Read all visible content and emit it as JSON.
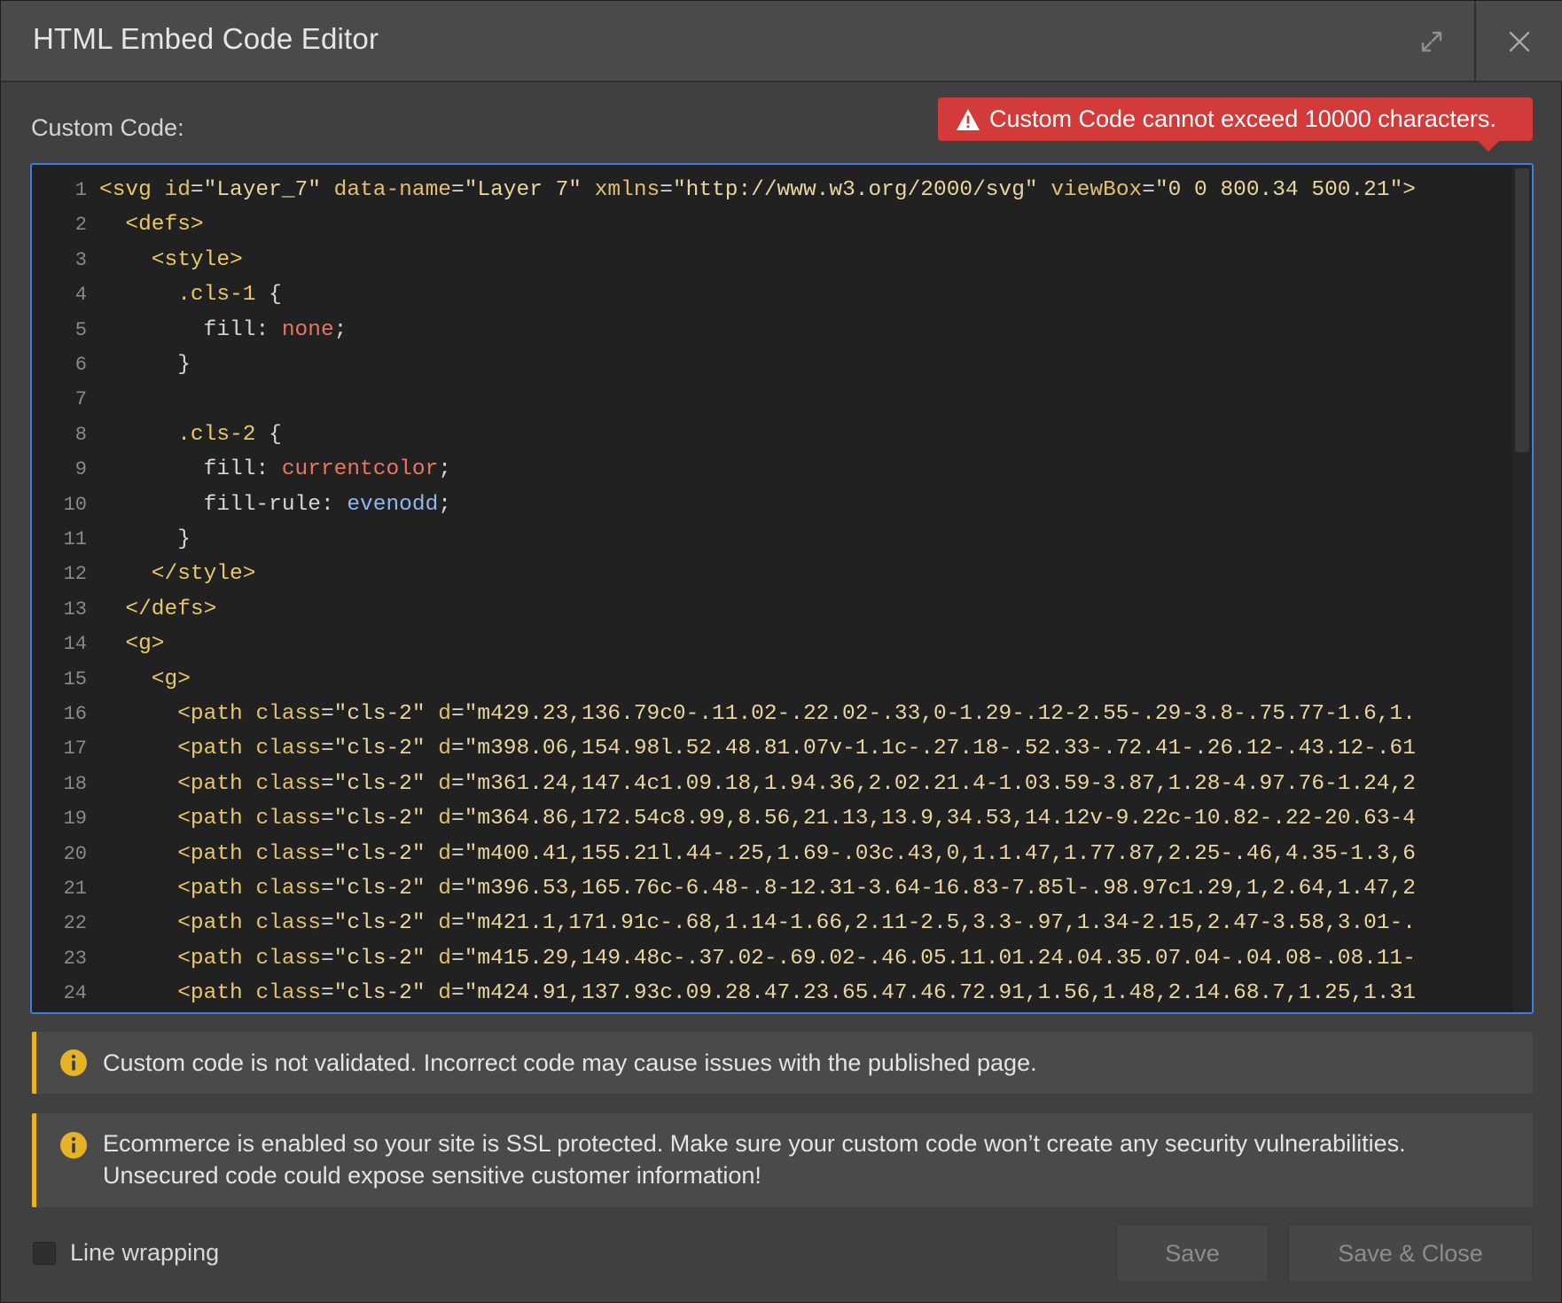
{
  "dialog": {
    "title": "HTML Embed Code Editor",
    "expand_icon": "expand-icon",
    "close_icon": "close-icon"
  },
  "editor": {
    "label": "Custom Code:",
    "error": "Custom Code cannot exceed 10000 characters.",
    "lines": [
      {
        "n": "1",
        "tokens": [
          [
            "tag",
            "<svg "
          ],
          [
            "attr",
            "id"
          ],
          [
            "punc",
            "="
          ],
          [
            "str",
            "\"Layer_7\" "
          ],
          [
            "attr",
            "data-name"
          ],
          [
            "punc",
            "="
          ],
          [
            "str",
            "\"Layer 7\" "
          ],
          [
            "attr",
            "xmlns"
          ],
          [
            "punc",
            "="
          ],
          [
            "str",
            "\"http://www.w3.org/2000/svg\" "
          ],
          [
            "attr",
            "viewBox"
          ],
          [
            "punc",
            "="
          ],
          [
            "str",
            "\"0 0 800.34 500.21\">"
          ]
        ]
      },
      {
        "n": "2",
        "tokens": [
          [
            "tag",
            "  <defs>"
          ]
        ]
      },
      {
        "n": "3",
        "tokens": [
          [
            "tag",
            "    <style>"
          ]
        ]
      },
      {
        "n": "4",
        "tokens": [
          [
            "sel",
            "      .cls-1 "
          ],
          [
            "punc",
            "{"
          ]
        ]
      },
      {
        "n": "5",
        "tokens": [
          [
            "prop",
            "        fill"
          ],
          [
            "punc",
            ": "
          ],
          [
            "valred",
            "none"
          ],
          [
            "punc",
            ";"
          ]
        ]
      },
      {
        "n": "6",
        "tokens": [
          [
            "punc",
            "      }"
          ]
        ]
      },
      {
        "n": "7",
        "tokens": []
      },
      {
        "n": "8",
        "tokens": [
          [
            "sel",
            "      .cls-2 "
          ],
          [
            "punc",
            "{"
          ]
        ]
      },
      {
        "n": "9",
        "tokens": [
          [
            "prop",
            "        fill"
          ],
          [
            "punc",
            ": "
          ],
          [
            "valred",
            "currentcolor"
          ],
          [
            "punc",
            ";"
          ]
        ]
      },
      {
        "n": "10",
        "tokens": [
          [
            "prop",
            "        fill-rule"
          ],
          [
            "punc",
            ": "
          ],
          [
            "valblue",
            "evenodd"
          ],
          [
            "punc",
            ";"
          ]
        ]
      },
      {
        "n": "11",
        "tokens": [
          [
            "punc",
            "      }"
          ]
        ]
      },
      {
        "n": "12",
        "tokens": [
          [
            "tag",
            "    </style>"
          ]
        ]
      },
      {
        "n": "13",
        "tokens": [
          [
            "tag",
            "  </defs>"
          ]
        ]
      },
      {
        "n": "14",
        "tokens": [
          [
            "tag",
            "  <g>"
          ]
        ]
      },
      {
        "n": "15",
        "tokens": [
          [
            "tag",
            "    <g>"
          ]
        ]
      },
      {
        "n": "16",
        "tokens": [
          [
            "tag",
            "      <path "
          ],
          [
            "attr",
            "class"
          ],
          [
            "punc",
            "="
          ],
          [
            "str",
            "\"cls-2\" "
          ],
          [
            "attr",
            "d"
          ],
          [
            "punc",
            "="
          ],
          [
            "str",
            "\"m429.23,136.79c0-.11.02-.22.02-.33,0-1.29-.12-2.55-.29-3.8-.75.77-1.6,1."
          ]
        ]
      },
      {
        "n": "17",
        "tokens": [
          [
            "tag",
            "      <path "
          ],
          [
            "attr",
            "class"
          ],
          [
            "punc",
            "="
          ],
          [
            "str",
            "\"cls-2\" "
          ],
          [
            "attr",
            "d"
          ],
          [
            "punc",
            "="
          ],
          [
            "str",
            "\"m398.06,154.98l.52.48.81.07v-1.1c-.27.18-.52.33-.72.41-.26.12-.43.12-.61"
          ]
        ]
      },
      {
        "n": "18",
        "tokens": [
          [
            "tag",
            "      <path "
          ],
          [
            "attr",
            "class"
          ],
          [
            "punc",
            "="
          ],
          [
            "str",
            "\"cls-2\" "
          ],
          [
            "attr",
            "d"
          ],
          [
            "punc",
            "="
          ],
          [
            "str",
            "\"m361.24,147.4c1.09.18,1.94.36,2.02.21.4-1.03.59-3.87,1.28-4.97.76-1.24,2"
          ]
        ]
      },
      {
        "n": "19",
        "tokens": [
          [
            "tag",
            "      <path "
          ],
          [
            "attr",
            "class"
          ],
          [
            "punc",
            "="
          ],
          [
            "str",
            "\"cls-2\" "
          ],
          [
            "attr",
            "d"
          ],
          [
            "punc",
            "="
          ],
          [
            "str",
            "\"m364.86,172.54c8.99,8.56,21.13,13.9,34.53,14.12v-9.22c-10.82-.22-20.63-4"
          ]
        ]
      },
      {
        "n": "20",
        "tokens": [
          [
            "tag",
            "      <path "
          ],
          [
            "attr",
            "class"
          ],
          [
            "punc",
            "="
          ],
          [
            "str",
            "\"cls-2\" "
          ],
          [
            "attr",
            "d"
          ],
          [
            "punc",
            "="
          ],
          [
            "str",
            "\"m400.41,155.21l.44-.25,1.69-.03c.43,0,1.1.47,1.77.87,2.25-.46,4.35-1.3,6"
          ]
        ]
      },
      {
        "n": "21",
        "tokens": [
          [
            "tag",
            "      <path "
          ],
          [
            "attr",
            "class"
          ],
          [
            "punc",
            "="
          ],
          [
            "str",
            "\"cls-2\" "
          ],
          [
            "attr",
            "d"
          ],
          [
            "punc",
            "="
          ],
          [
            "str",
            "\"m396.53,165.76c-6.48-.8-12.31-3.64-16.83-7.85l-.98.97c1.29,1,2.64,1.47,2"
          ]
        ]
      },
      {
        "n": "22",
        "tokens": [
          [
            "tag",
            "      <path "
          ],
          [
            "attr",
            "class"
          ],
          [
            "punc",
            "="
          ],
          [
            "str",
            "\"cls-2\" "
          ],
          [
            "attr",
            "d"
          ],
          [
            "punc",
            "="
          ],
          [
            "str",
            "\"m421.1,171.91c-.68,1.14-1.66,2.11-2.5,3.3-.97,1.34-2.15,2.47-3.58,3.01-."
          ]
        ]
      },
      {
        "n": "23",
        "tokens": [
          [
            "tag",
            "      <path "
          ],
          [
            "attr",
            "class"
          ],
          [
            "punc",
            "="
          ],
          [
            "str",
            "\"cls-2\" "
          ],
          [
            "attr",
            "d"
          ],
          [
            "punc",
            "="
          ],
          [
            "str",
            "\"m415.29,149.48c-.37.02-.69.02-.46.05.11.01.24.04.35.07.04-.04.08-.08.11-"
          ]
        ]
      },
      {
        "n": "24",
        "tokens": [
          [
            "tag",
            "      <path "
          ],
          [
            "attr",
            "class"
          ],
          [
            "punc",
            "="
          ],
          [
            "str",
            "\"cls-2\" "
          ],
          [
            "attr",
            "d"
          ],
          [
            "punc",
            "="
          ],
          [
            "str",
            "\"m424.91,137.93c.09.28.47.23.65.47.46.72.91,1.56,1.48,2.14.68.7,1.25,1.31"
          ]
        ]
      }
    ]
  },
  "notices": [
    {
      "icon": "info-icon",
      "lines": [
        "Custom code is not validated. Incorrect code may cause issues with the published page."
      ]
    },
    {
      "icon": "info-icon",
      "lines": [
        "Ecommerce is enabled so your site is SSL protected. Make sure your custom code won’t create any security vulnerabilities.",
        "Unsecured code could expose sensitive customer information!"
      ]
    }
  ],
  "footer": {
    "line_wrapping_label": "Line wrapping",
    "line_wrapping_checked": false,
    "save_label": "Save",
    "save_close_label": "Save & Close"
  },
  "colors": {
    "accent_border": "#3d7fe0",
    "error_bg": "#d33a3a",
    "notice_accent": "#e5b325"
  }
}
